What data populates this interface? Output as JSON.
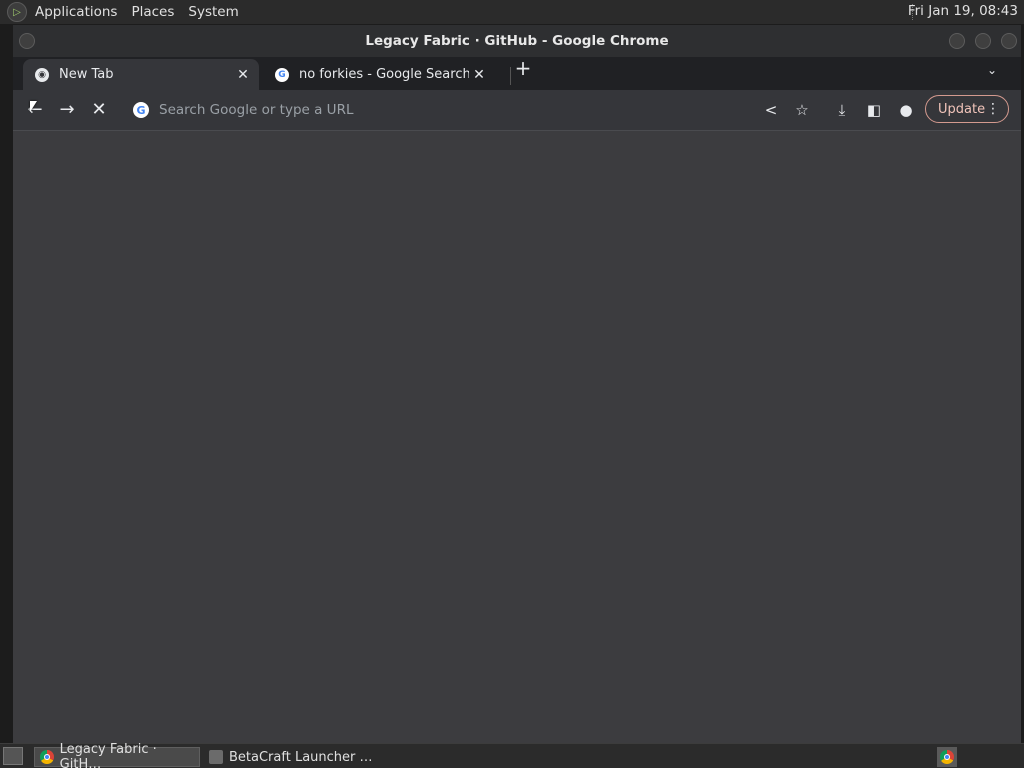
{
  "topbar": {
    "menu": [
      "Applications",
      "Places",
      "System"
    ],
    "clock": "Fri Jan 19, 08:43"
  },
  "window": {
    "title": "Legacy Fabric · GitHub - Google Chrome"
  },
  "tabs": [
    {
      "label": "New Tab",
      "icon": "chrome-icon",
      "active": true
    },
    {
      "label": "no forkies - Google Search",
      "icon": "google-icon",
      "active": false
    }
  ],
  "toolbar": {
    "omnibox_placeholder": "Search Google or type a URL",
    "update_label": "Update"
  },
  "taskbar": {
    "tasks": [
      {
        "label": "Legacy Fabric · GitH…",
        "icon": "chrome-icon"
      },
      {
        "label": "BetaCraft Launcher …",
        "icon": "app-icon"
      }
    ]
  },
  "colors": {
    "content_bg": "#3c3c3f",
    "toolbar_bg": "#35363a",
    "update_accent": "#d49a8f"
  }
}
